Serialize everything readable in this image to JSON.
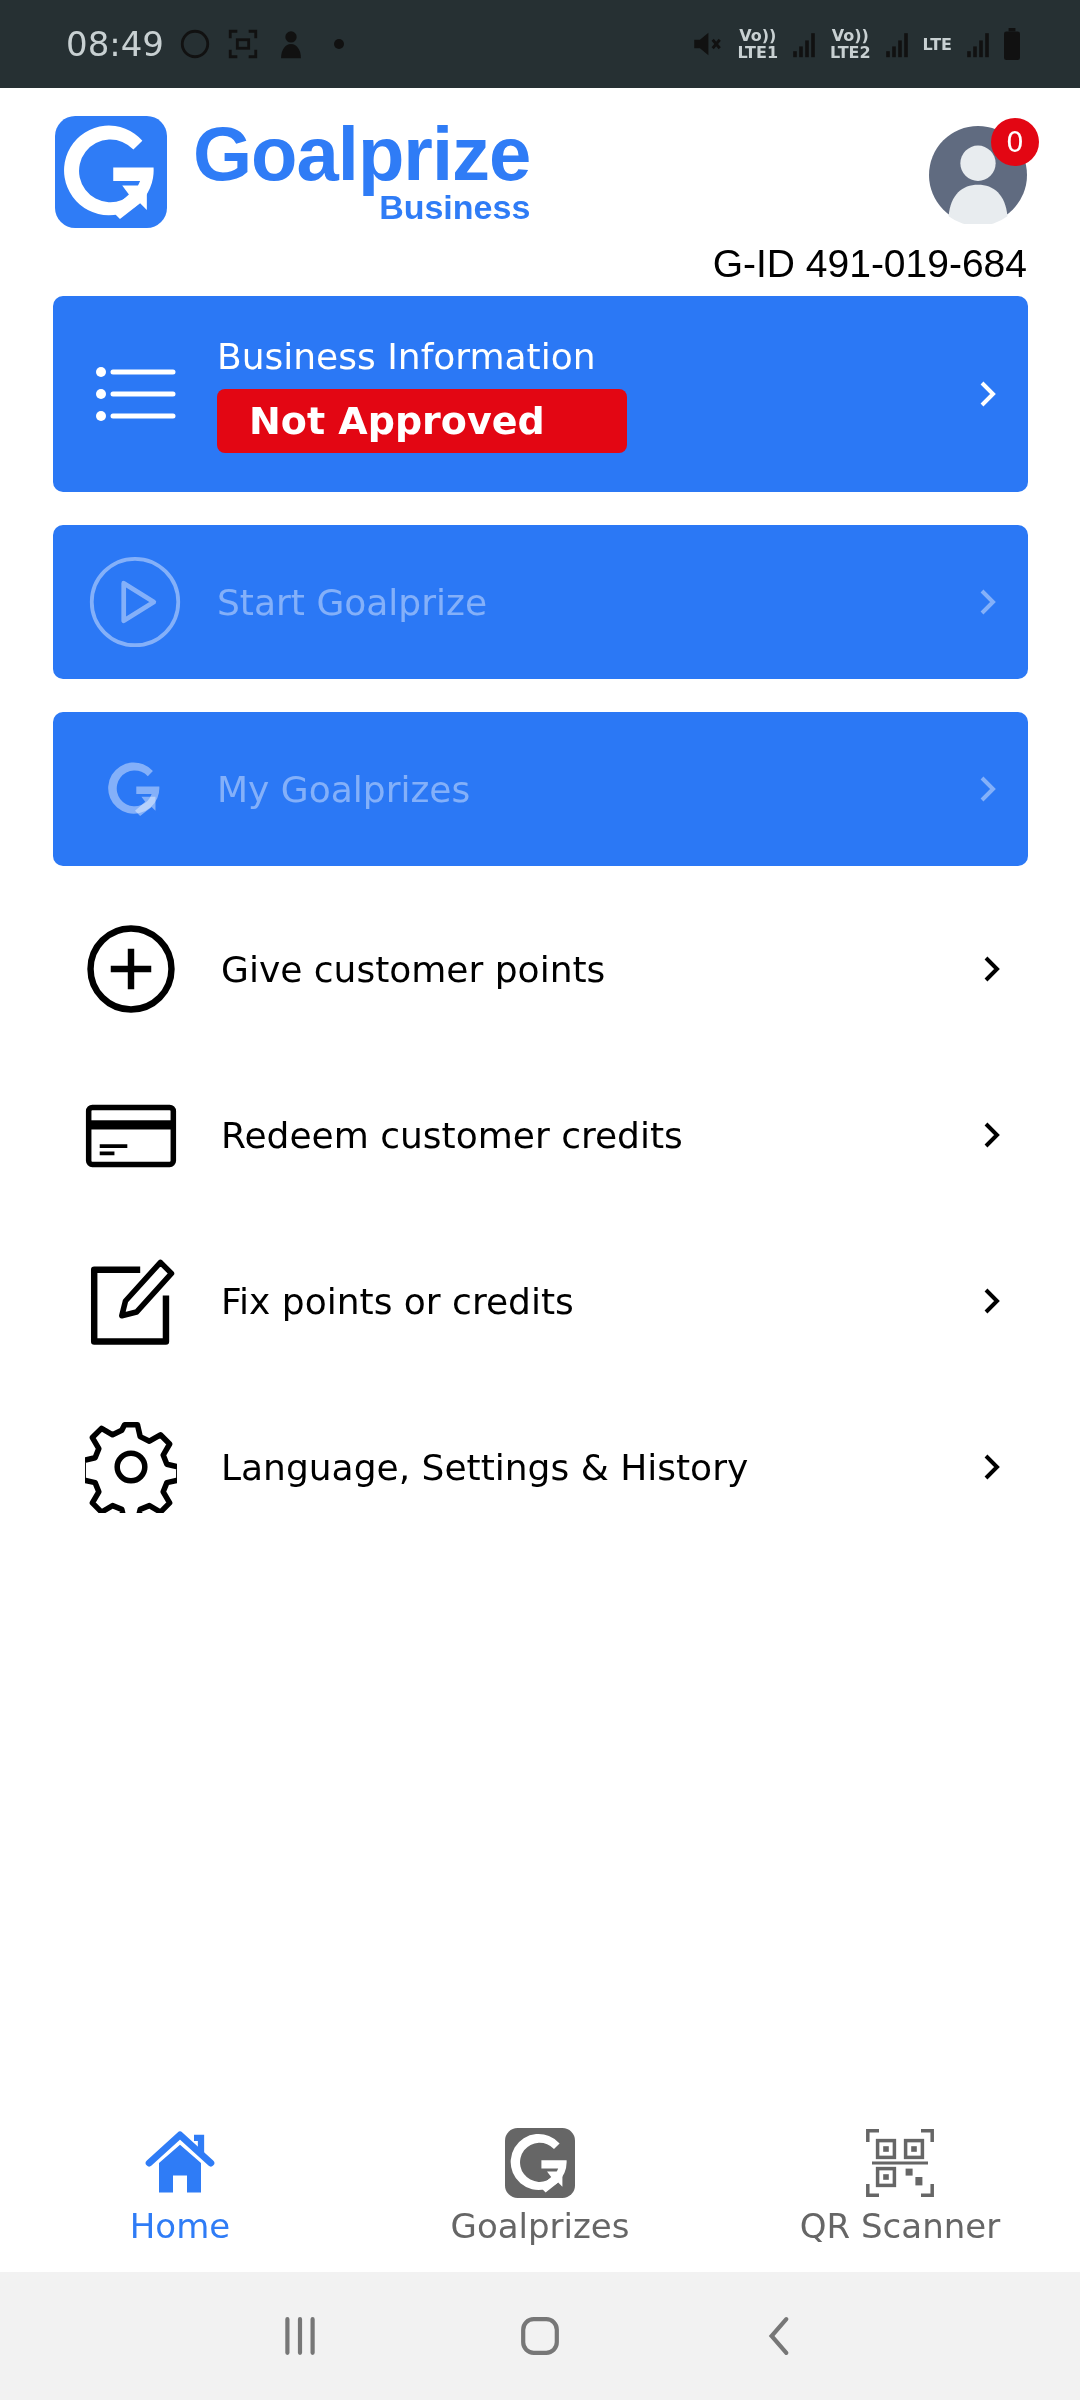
{
  "status_bar": {
    "time": "08:49",
    "sim_labels": [
      {
        "top": "Vo))",
        "bottom": "LTE1"
      },
      {
        "top": "Vo))",
        "bottom": "LTE2"
      },
      {
        "top": "LTE"
      }
    ]
  },
  "header": {
    "brand": "Goalprize",
    "brand_sub": "Business",
    "notification_count": "0",
    "gid": "G-ID 491-019-684"
  },
  "cards": [
    {
      "kind": "list",
      "title": "Business Information",
      "badge": "Not Approved",
      "disabled": false
    },
    {
      "kind": "play",
      "title": "Start Goalprize",
      "disabled": true
    },
    {
      "kind": "logo",
      "title": "My Goalprizes",
      "disabled": true
    }
  ],
  "menu": [
    {
      "kind": "add",
      "label": "Give customer points"
    },
    {
      "kind": "redeem",
      "label": "Redeem customer credits"
    },
    {
      "kind": "fix",
      "label": "Fix points or credits"
    },
    {
      "kind": "settings",
      "label": "Language, Settings & History"
    }
  ],
  "bottom_nav": [
    {
      "kind": "home",
      "label": "Home",
      "selected": true
    },
    {
      "kind": "logo",
      "label": "Goalprizes",
      "selected": false
    },
    {
      "kind": "scanner",
      "label": "QR Scanner",
      "selected": false
    }
  ]
}
